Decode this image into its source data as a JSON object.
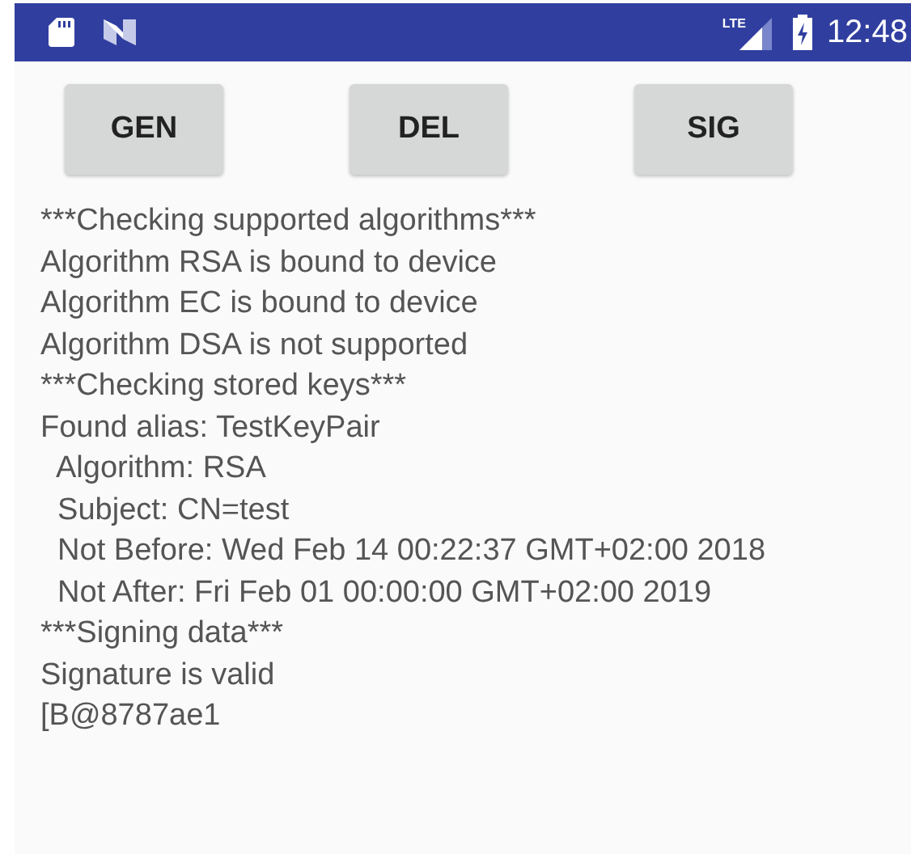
{
  "status_bar": {
    "network": "LTE",
    "time": "12:48"
  },
  "buttons": [
    {
      "label": "GEN"
    },
    {
      "label": "DEL"
    },
    {
      "label": "SIG"
    }
  ],
  "log_lines": [
    "***Checking supported algorithms***",
    "Algorithm RSA is bound to device",
    "Algorithm EC is bound to device",
    "Algorithm DSA is not supported",
    "***Checking stored keys***",
    "Found alias: TestKeyPair",
    "  Algorithm: RSA",
    "  Subject: CN=test",
    "  Not Before: Wed Feb 14 00:22:37 GMT+02:00 2018",
    "  Not After: Fri Feb 01 00:00:00 GMT+02:00 2019",
    "***Signing data***",
    "Signature is valid",
    "[B@8787ae1"
  ]
}
